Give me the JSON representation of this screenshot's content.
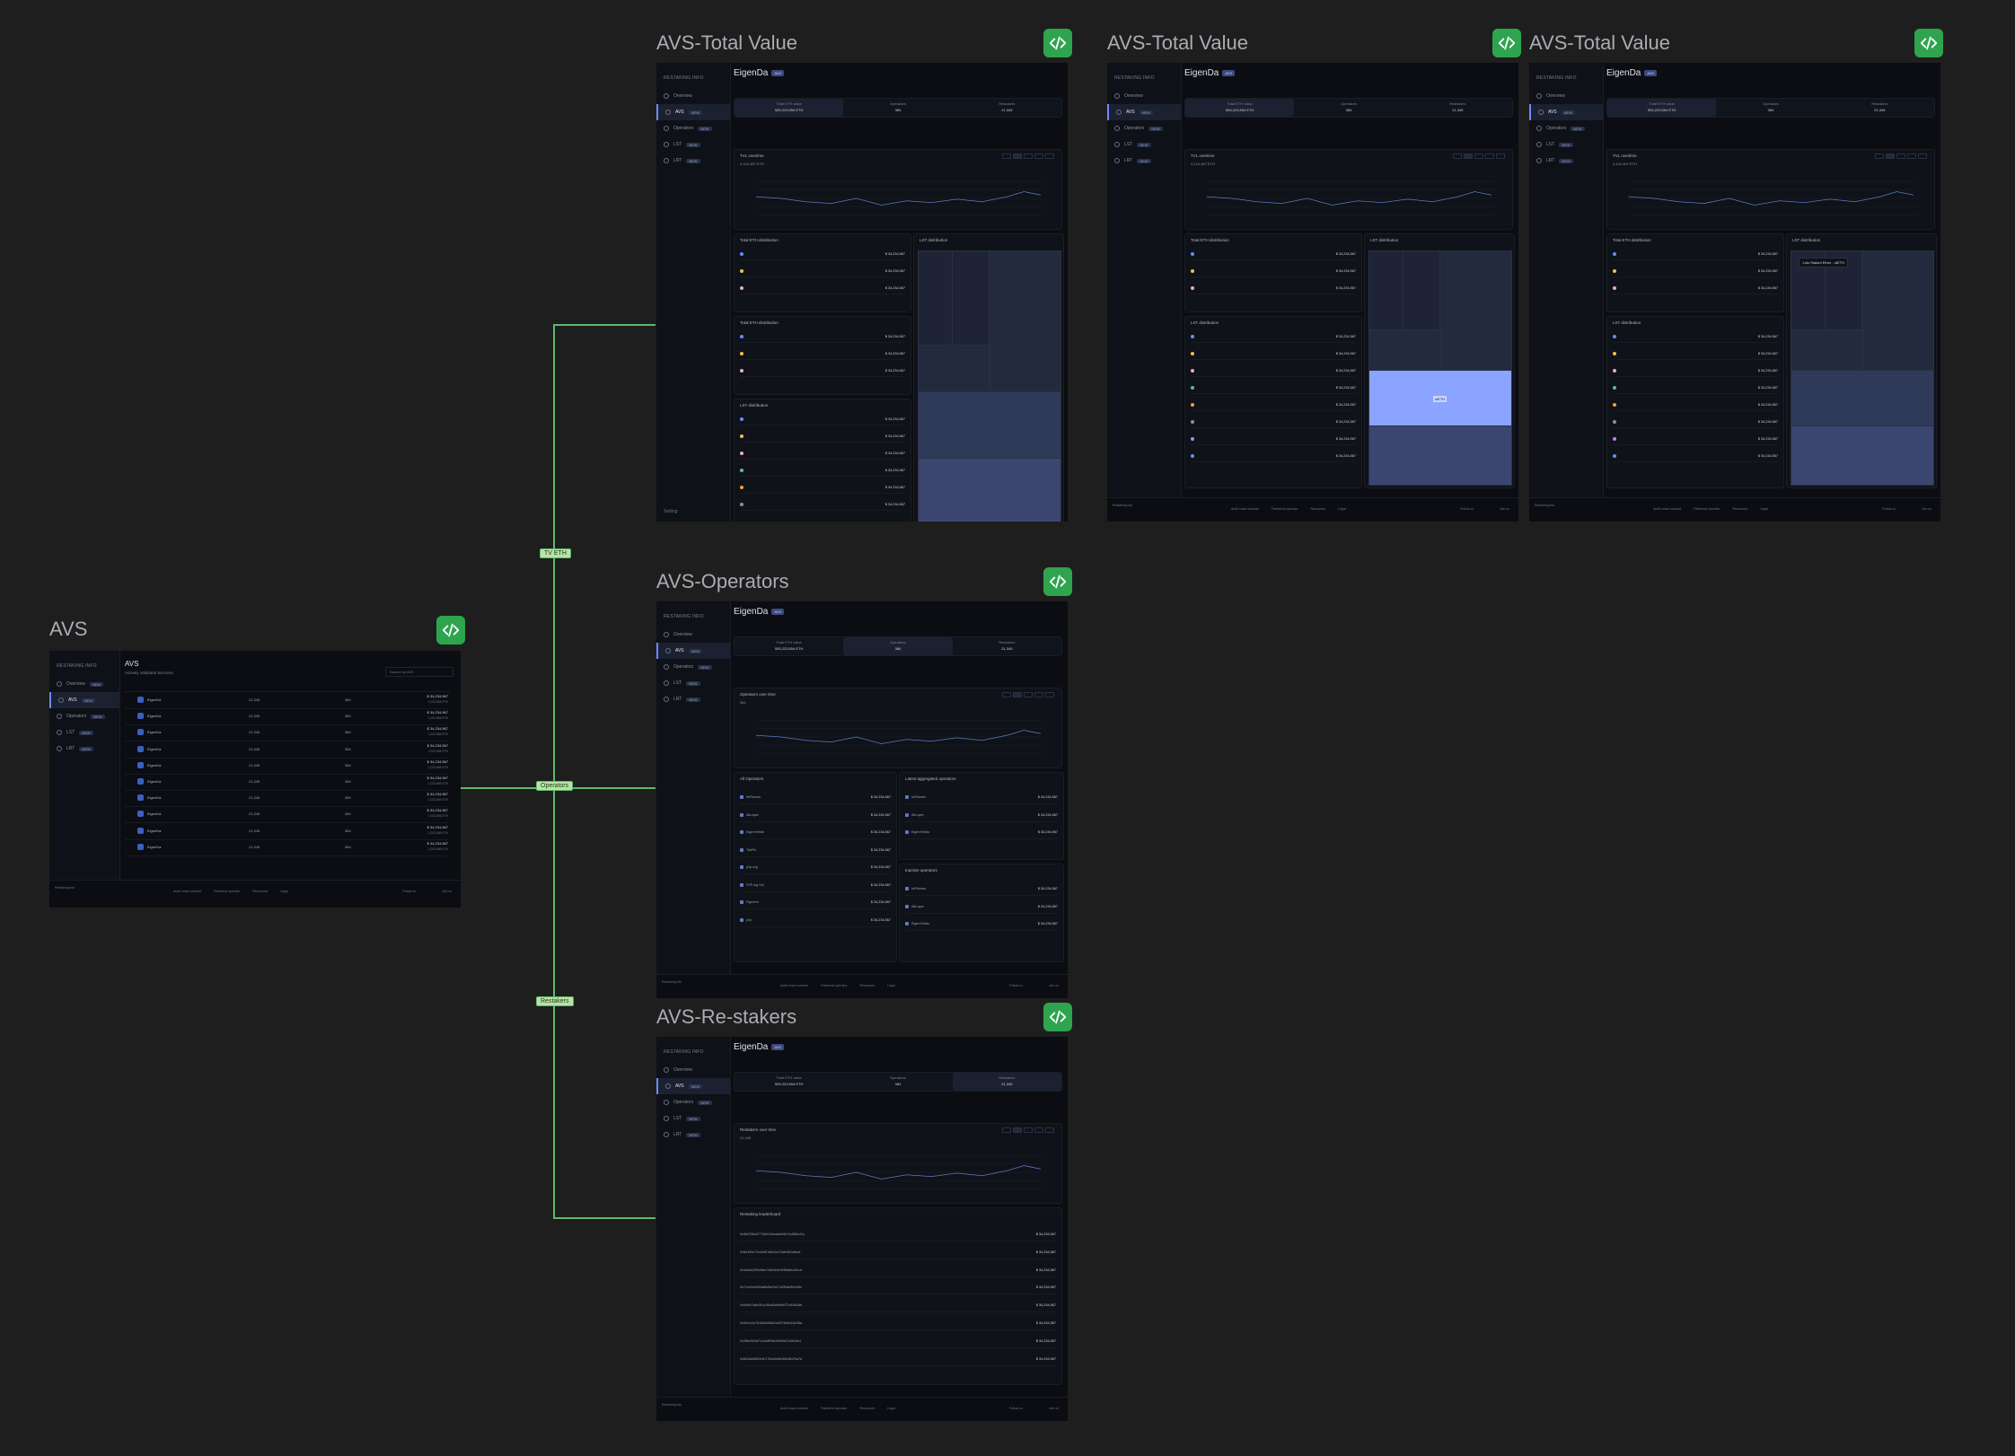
{
  "frames": {
    "avs": {
      "title": "AVS"
    },
    "tv1": {
      "title": "AVS-Total Value"
    },
    "tv2": {
      "title": "AVS-Total Value"
    },
    "tv3": {
      "title": "AVS-Total Value"
    },
    "operators": {
      "title": "AVS-Operators"
    },
    "restakers": {
      "title": "AVS-Re-stakers"
    }
  },
  "edges": {
    "tv": "TV ETH",
    "operators": "Operators",
    "restakers": "Restakers"
  },
  "app": {
    "brand": "RESTAKING",
    "brand_sub": "INFO",
    "nav": [
      "Overview",
      "AVS",
      "Operators",
      "LST",
      "LRT"
    ],
    "setting": "Setting",
    "avs_heading": "AVS",
    "avs_subheading": "Actively Validated Services",
    "search_placeholder": "Search by AVS",
    "avs_name": "EigenDa",
    "avs_badge": "AVS",
    "stats": {
      "tv_label": "Total ETH value",
      "tv_value": "553,223,554 ETH",
      "ops_label": "Operators",
      "ops_value": "384",
      "restakers_label": "Restakers",
      "restakers_value": "21,345"
    },
    "tvl_title": "TVL overtime",
    "tvl_value": "4,124,487 ETH",
    "tvl_change": "+14%",
    "ops_chart_title": "Operators over time",
    "ops_chart_value": "384",
    "restakers_chart_title": "Restakers over time",
    "restakers_chart_value": "21,345",
    "total_eth_title": "Total ETH distribution",
    "lst_title": "LST distribution",
    "treemap_tooltip": "Lido Staked Ether - stETH",
    "treemap_label": "stETH",
    "all_operators": "All Operators",
    "latest_ops": "Latest aggregated operators",
    "inactive_ops": "Inactive operators",
    "restaking_leaderboard": "Restaking leaderboard",
    "operator_names": [
      "InfStones",
      "AltLayer",
      "EigenYields",
      "TokFin",
      "p2p.org",
      "P2P.org Sol",
      "Figment",
      "p2p"
    ],
    "restaker_addresses": [
      "0x3b67f6a4771b9c3deafa4e5b7ed6f0c41c",
      "0x8a1f9e73c2d457afb2c47a9e3b0dfca1",
      "0x4ab6c2f3b48ec7a9d16e92f5a8ed41cd",
      "0x7c1e0d4f92a8b65e3c17d2f0ab84e96c",
      "0x5d9b7a6e3f1c284d0a9e5bf72c63d18e",
      "0x9e4c2a7f1b6d3e58c0a2f74b9d16e35a",
      "0x2f6e9b3d7c1a48f05e2b9c6d7a3f18e4",
      "0x6b3a8d5f2e9c17b4a0d6e3f5c8b29a7d"
    ],
    "value_eth": "$ 34,234,567",
    "value_sub": "1,023,566 ETH",
    "footer_brand": "Restaking info",
    "footer_links": [
      "Audit smart contract",
      "Partnered operator",
      "Resources",
      "Legal"
    ],
    "follow": "Follow us",
    "join": "Join us"
  }
}
